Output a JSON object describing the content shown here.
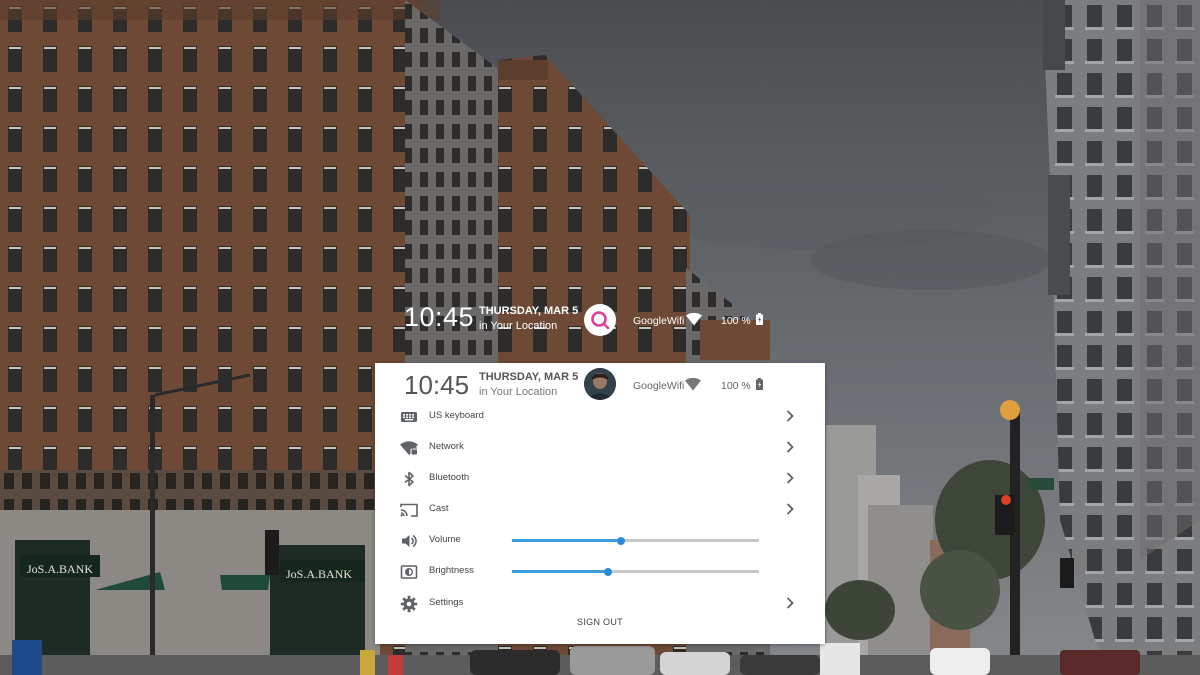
{
  "shelf": {
    "time": "10:45",
    "date": "THURSDAY, MAR 5",
    "location": "in Your Location",
    "network_name": "GoogleWifi",
    "battery": "100 %"
  },
  "tray": {
    "time": "10:45",
    "date": "THURSDAY, MAR 5",
    "location": "in Your Location",
    "network_name": "GoogleWifi",
    "battery": "100 %",
    "items": [
      {
        "label": "US keyboard",
        "icon": "keyboard-icon"
      },
      {
        "label": "Network",
        "icon": "network-icon"
      },
      {
        "label": "Bluetooth",
        "icon": "bluetooth-icon"
      },
      {
        "label": "Cast",
        "icon": "cast-icon"
      },
      {
        "label": "Volume",
        "icon": "volume-icon",
        "level": 0.44
      },
      {
        "label": "Brightness",
        "icon": "brightness-icon",
        "level": 0.39
      },
      {
        "label": "Settings",
        "icon": "gear-icon"
      }
    ],
    "sign_out": "SIGN OUT"
  },
  "colors": {
    "accent": "#2a8cd8",
    "avatar_ring": "#e0409a"
  },
  "wallpaper_signs": {
    "store_sign_left": "JoS.A.BANK",
    "store_sign_center": "JoS.A.BANK"
  }
}
